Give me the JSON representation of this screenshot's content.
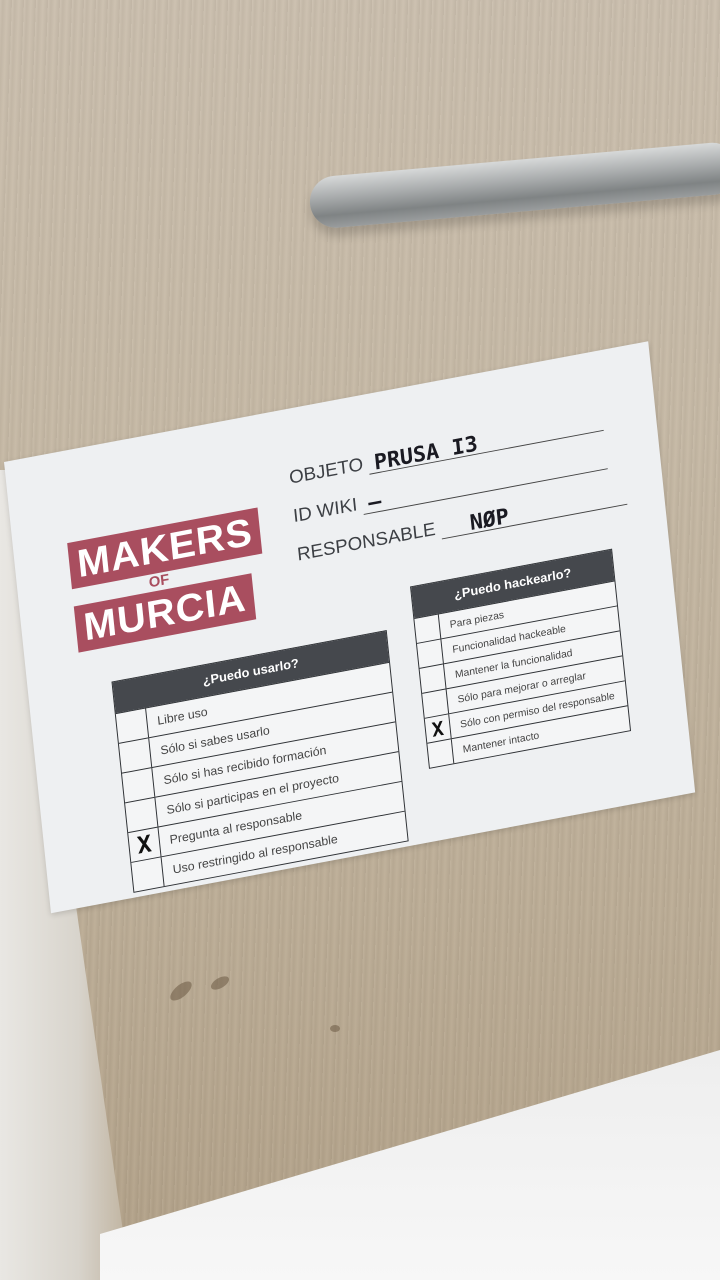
{
  "sheet": {
    "logo": {
      "line1": "MAKERS",
      "line2": "OF",
      "line3": "MURCIA"
    },
    "fields": [
      {
        "label": "OBJETO",
        "value": "PRUSA I3"
      },
      {
        "label": "ID WIKI",
        "value": "—"
      },
      {
        "label": "RESPONSABLE",
        "value": "NØP"
      }
    ],
    "usarlo": {
      "title": "¿Puedo usarlo?",
      "items": [
        {
          "label": "Libre uso",
          "mark": ""
        },
        {
          "label": "Sólo si sabes usarlo",
          "mark": ""
        },
        {
          "label": "Sólo si has recibido formación",
          "mark": ""
        },
        {
          "label": "Sólo si participas en el proyecto",
          "mark": ""
        },
        {
          "label": "Pregunta al responsable",
          "mark": "X"
        },
        {
          "label": "Uso restringido al responsable",
          "mark": ""
        }
      ]
    },
    "hackearlo": {
      "title": "¿Puedo hackearlo?",
      "items": [
        {
          "label": "Para piezas",
          "mark": ""
        },
        {
          "label": "Funcionalidad hackeable",
          "mark": ""
        },
        {
          "label": "Mantener la funcionalidad",
          "mark": ""
        },
        {
          "label": "Sólo para mejorar o arreglar",
          "mark": ""
        },
        {
          "label": "Sólo con permiso del responsable",
          "mark": "X"
        },
        {
          "label": "Mantener intacto",
          "mark": ""
        }
      ]
    }
  }
}
